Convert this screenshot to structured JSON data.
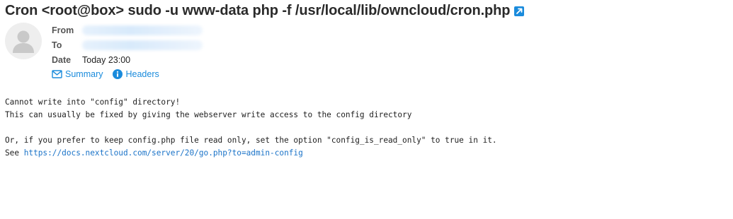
{
  "message": {
    "subject": "Cron <root@box> sudo -u www-data php -f /usr/local/lib/owncloud/cron.php",
    "headers": {
      "from_label": "From",
      "to_label": "To",
      "date_label": "Date",
      "date_value": "Today 23:00"
    },
    "actions": {
      "summary_label": "Summary",
      "headers_label": "Headers"
    },
    "body": {
      "line1": "Cannot write into \"config\" directory!",
      "line2": "This can usually be fixed by giving the webserver write access to the config directory",
      "line3": "Or, if you prefer to keep config.php file read only, set the option \"config_is_read_only\" to true in it.",
      "line4_prefix": "See ",
      "link_text": "https://docs.nextcloud.com/server/20/go.php?to=admin-config"
    }
  },
  "icons": {
    "popout": "external-link-icon",
    "avatar": "user-avatar-icon",
    "summary": "envelope-icon",
    "headers": "info-icon"
  },
  "colors": {
    "accent": "#1a8bdc",
    "avatar_bg": "#eeeeee",
    "avatar_fg": "#c9c9c9"
  }
}
